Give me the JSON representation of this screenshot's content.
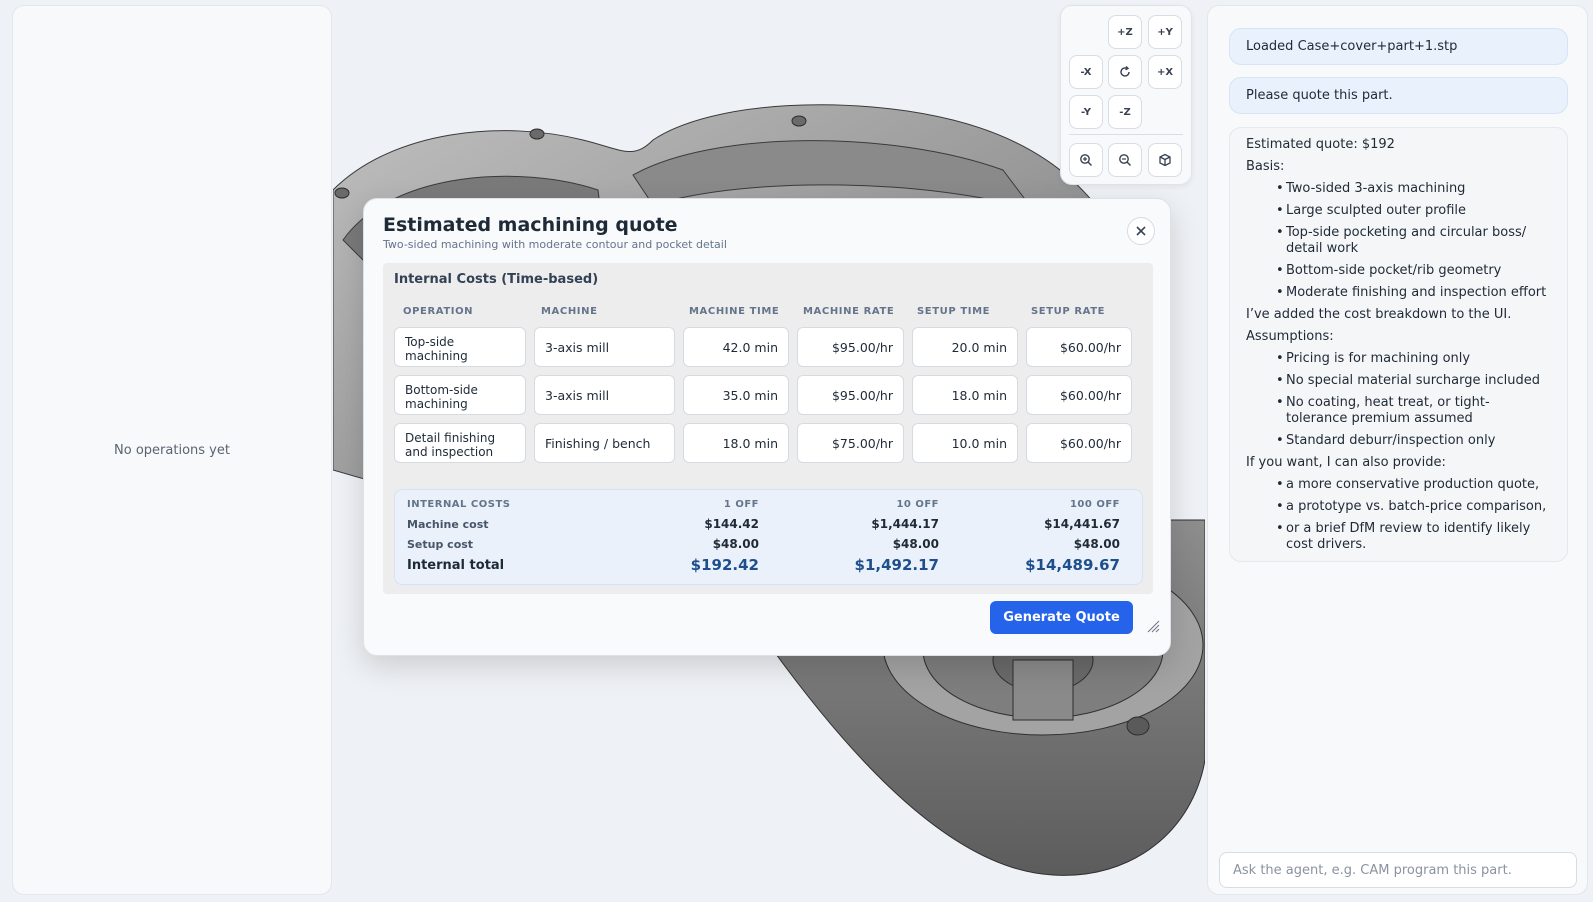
{
  "left_panel": {
    "empty_text": "No operations yet"
  },
  "view_controls": {
    "buttons": [
      "+Z",
      "+Y",
      "-X",
      "+X",
      "-Y",
      "-Z"
    ],
    "icons": [
      "rotate-icon",
      "zoom-in-icon",
      "zoom-out-icon",
      "iso-view-icon"
    ]
  },
  "modal": {
    "title": "Estimated machining quote",
    "subtitle": "Two-sided machining with moderate contour and pocket detail",
    "close_icon": "close-icon",
    "section_title": "Internal Costs (Time-based)",
    "columns": [
      "OPERATION",
      "MACHINE",
      "MACHINE TIME",
      "MACHINE RATE",
      "SETUP TIME",
      "SETUP RATE"
    ],
    "rows": [
      {
        "operation": "Top-side machining",
        "machine": "3-axis mill",
        "machine_time": "42.0 min",
        "machine_rate": "$95.00/hr",
        "setup_time": "20.0 min",
        "setup_rate": "$60.00/hr"
      },
      {
        "operation": "Bottom-side machining",
        "machine": "3-axis mill",
        "machine_time": "35.0 min",
        "machine_rate": "$95.00/hr",
        "setup_time": "18.0 min",
        "setup_rate": "$60.00/hr"
      },
      {
        "operation": "Detail finishing and inspection",
        "machine": "Finishing / bench",
        "machine_time": "18.0 min",
        "machine_rate": "$75.00/hr",
        "setup_time": "10.0 min",
        "setup_rate": "$60.00/hr"
      }
    ],
    "totals": {
      "header_label": "INTERNAL COSTS",
      "qty_headers": [
        "1 OFF",
        "10 OFF",
        "100 OFF"
      ],
      "machine_cost_label": "Machine cost",
      "machine_cost": [
        "$144.42",
        "$1,444.17",
        "$14,441.67"
      ],
      "setup_cost_label": "Setup cost",
      "setup_cost": [
        "$48.00",
        "$48.00",
        "$48.00"
      ],
      "internal_total_label": "Internal total",
      "internal_total": [
        "$192.42",
        "$1,492.17",
        "$14,489.67"
      ]
    },
    "generate_button": "Generate Quote"
  },
  "chat": {
    "user_messages": [
      "Loaded Case+cover+part+1.stp",
      "Please quote this part."
    ],
    "agent": {
      "quote_line": "Estimated quote: $192",
      "basis_label": "Basis:",
      "basis": [
        "Two-sided 3-axis machining",
        "Large sculpted outer profile",
        "Top-side pocketing and circular boss/ detail work",
        "Bottom-side pocket/rib geometry",
        "Moderate finishing and inspection effort"
      ],
      "added_line": "I’ve added the cost breakdown to the UI.",
      "assumptions_label": "Assumptions:",
      "assumptions": [
        "Pricing is for machining only",
        "No special material surcharge included",
        "No coating, heat treat, or tight-tolerance premium assumed",
        "Standard deburr/inspection only"
      ],
      "offer_line": "If you want, I can also provide:",
      "offers": [
        "a more conservative production quote,",
        "a prototype vs. batch-price comparison,",
        "or a brief DfM review to identify likely cost drivers."
      ]
    },
    "input_placeholder": "Ask the agent, e.g. CAM program this part."
  },
  "colors": {
    "accent": "#2563eb",
    "total_text": "#1e4e8c",
    "totals_bg": "#eaf1fb"
  }
}
